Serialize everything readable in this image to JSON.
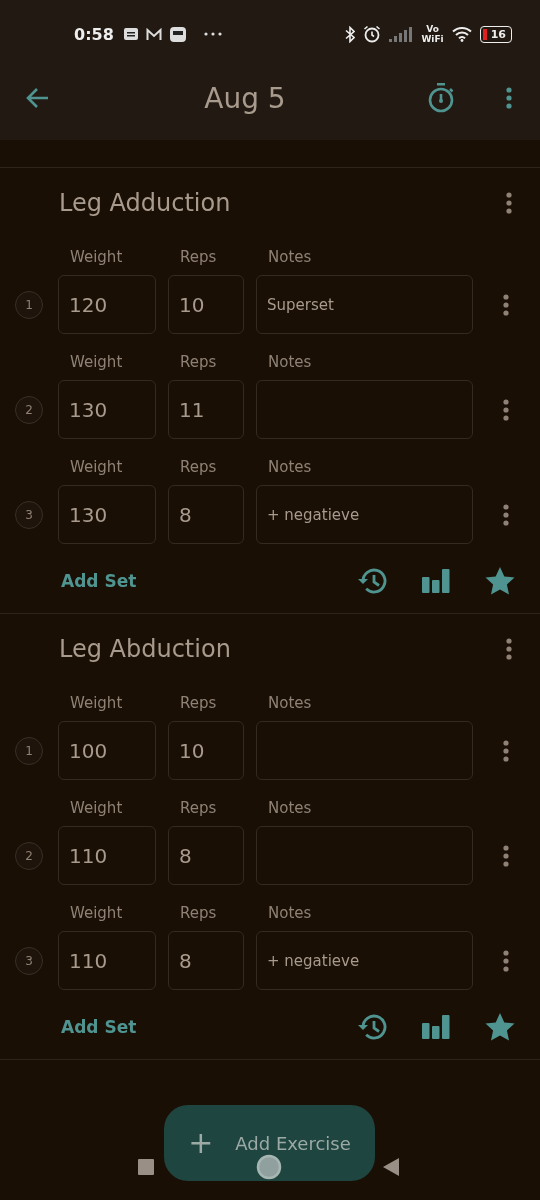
{
  "status_bar": {
    "time": "0:58",
    "network_label": [
      "Vo",
      "WiFi"
    ],
    "battery": "16"
  },
  "app_bar": {
    "title": "Aug 5"
  },
  "exercises": [
    {
      "name": "Leg Adduction",
      "add_set": "Add Set",
      "sets": [
        {
          "number": "1",
          "weight_label": "Weight",
          "weight": "120",
          "reps_label": "Reps",
          "reps": "10",
          "notes_label": "Notes",
          "notes": "Superset"
        },
        {
          "number": "2",
          "weight_label": "Weight",
          "weight": "130",
          "reps_label": "Reps",
          "reps": "11",
          "notes_label": "Notes"
        },
        {
          "number": "3",
          "weight_label": "Weight",
          "weight": "130",
          "reps_label": "Reps",
          "reps": "8",
          "notes_label": "Notes",
          "notes": "+ negatieve"
        }
      ]
    },
    {
      "name": "Leg Abduction",
      "add_set": "Add Set",
      "sets": [
        {
          "number": "1",
          "weight_label": "Weight",
          "weight": "100",
          "reps_label": "Reps",
          "reps": "10",
          "notes_label": "Notes"
        },
        {
          "number": "2",
          "weight_label": "Weight",
          "weight": "110",
          "reps_label": "Reps",
          "reps": "8",
          "notes_label": "Notes"
        },
        {
          "number": "3",
          "weight_label": "Weight",
          "weight": "110",
          "reps_label": "Reps",
          "reps": "8",
          "notes_label": "Notes",
          "notes": "+ negatieve"
        }
      ]
    }
  ],
  "fab": {
    "icon": "+",
    "label": "Add Exercise"
  }
}
